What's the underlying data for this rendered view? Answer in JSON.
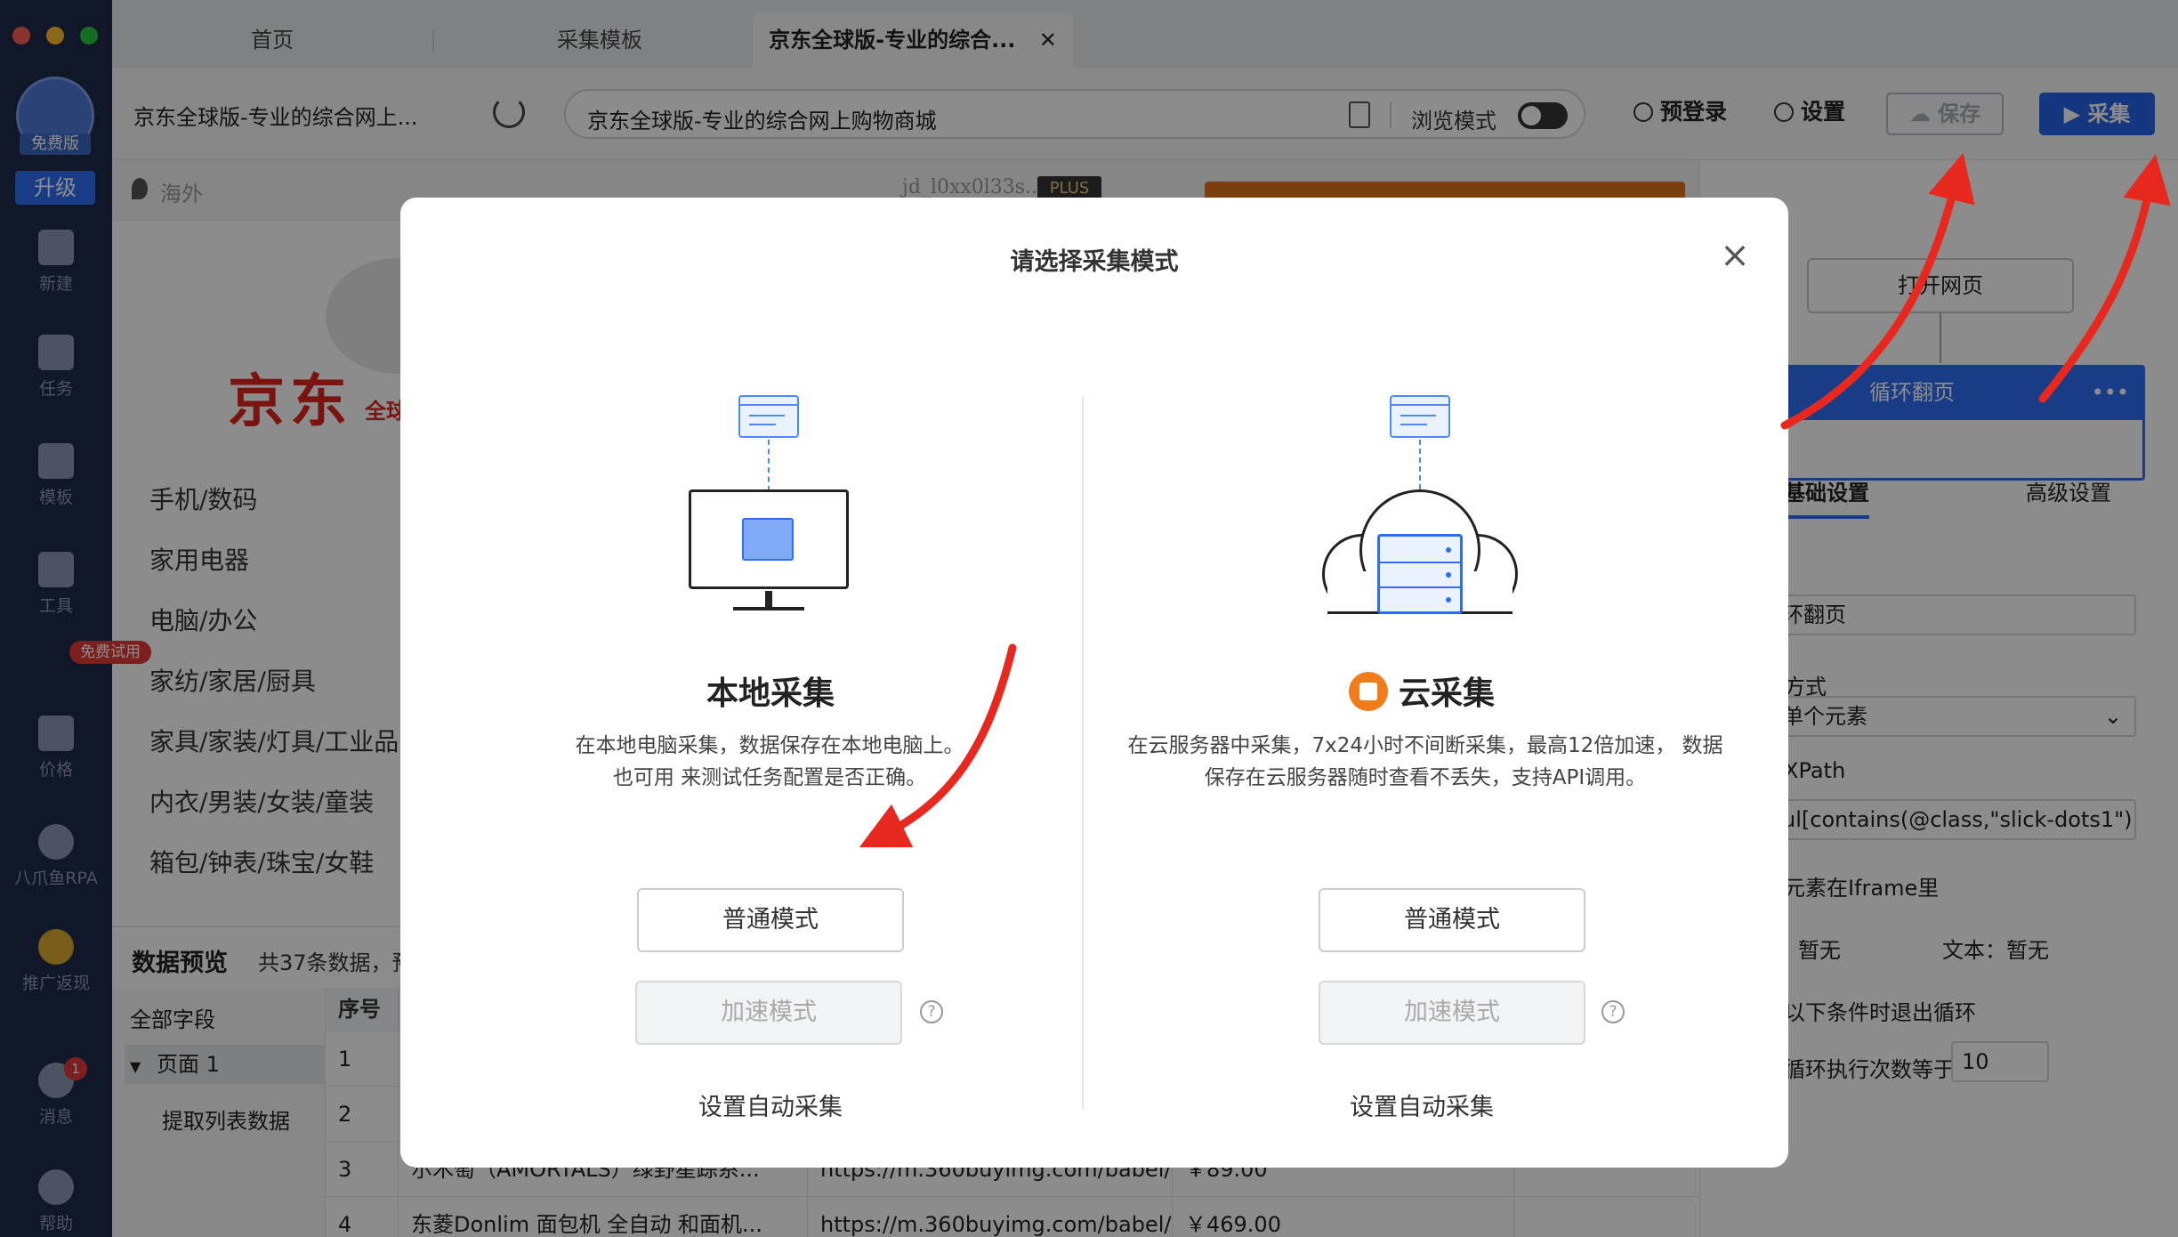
{
  "sidebar": {
    "free_badge": "免费版",
    "upgrade": "升级",
    "items": [
      {
        "label": "新建",
        "icon": "plus-icon"
      },
      {
        "label": "任务",
        "icon": "task-icon"
      },
      {
        "label": "模板",
        "icon": "template-icon"
      },
      {
        "label": "工具",
        "icon": "toolbox-icon"
      },
      {
        "label": "价格",
        "icon": "crown-icon"
      },
      {
        "label": "八爪鱼RPA",
        "icon": "octopus-icon"
      },
      {
        "label": "推广返现",
        "icon": "coin-icon"
      },
      {
        "label": "消息",
        "icon": "bell-icon"
      },
      {
        "label": "帮助",
        "icon": "help-icon"
      }
    ],
    "trial_badge": "免费试用",
    "message_count": "1"
  },
  "tabs": [
    {
      "label": "首页"
    },
    {
      "label": "采集模板"
    },
    {
      "label": "京东全球版-专业的综合..."
    }
  ],
  "toolbar": {
    "page_title": "京东全球版-专业的综合网上...",
    "url": "京东全球版-专业的综合网上购物商城",
    "browse_mode": "浏览模式",
    "prelogin": "预登录",
    "settings": "设置",
    "save": "保存",
    "collect": "采集"
  },
  "jd_page": {
    "location": "海外",
    "account": "jd_l0xx0l33s..",
    "plus": "PLUS",
    "logo": "京东",
    "global": "全球",
    "categories": [
      "手机/数码",
      "家用电器",
      "电脑/办公",
      "家纺/家居/厨具",
      "家具/家装/灯具/工业品",
      "内衣/男装/女装/童装",
      "箱包/钟表/珠宝/女鞋"
    ]
  },
  "preview": {
    "title": "数据预览",
    "count": "共37条数据，预",
    "all_fields": "全部字段",
    "page": "页面 1",
    "extract": "提取列表数据",
    "index_header": "序号",
    "rows": [
      {
        "index": "1",
        "name": "",
        "url": "",
        "price": ""
      },
      {
        "index": "2",
        "name": "",
        "url": "",
        "price": ""
      },
      {
        "index": "3",
        "name": "尔木萄（AMORTALS）绿野星踪系...",
        "url": "https://m.360buyimg.com/babel/...",
        "price": "￥89.00"
      },
      {
        "index": "4",
        "name": "东菱Donlim 面包机 全自动 和面机...",
        "url": "https://m.360buyimg.com/babel/...",
        "price": "￥469.00"
      }
    ]
  },
  "right_panel": {
    "open_page": "打开网页",
    "loop_page": "循环翻页",
    "tab_basic": "基础设置",
    "tab_advanced": "高级设置",
    "name_value": "环翻页",
    "mode_label": "方式",
    "mode_value": "单个元素",
    "xpath_label": "XPath",
    "xpath_value": "ul[contains(@class,\"slick-dots1\")",
    "iframe_label": "元素在Iframe里",
    "element_label": "暂无",
    "text_label": "文本：",
    "text_value": "暂无",
    "exit_label": "以下条件时退出循环",
    "count_label": "循环执行次数等于",
    "count_value": "10"
  },
  "modal": {
    "title": "请选择采集模式",
    "local": {
      "title": "本地采集",
      "desc1": "在本地电脑采集，数据保存在本地电脑上。",
      "desc2": "也可用 来测试任务配置是否正确。",
      "normal": "普通模式",
      "fast": "加速模式",
      "auto": "设置自动采集"
    },
    "cloud": {
      "title": "云采集",
      "desc": "在云服务器中采集，7x24小时不间断采集，最高12倍加速， 数据保存在云服务器随时查看不丢失，支持API调用。",
      "normal": "普通模式",
      "fast": "加速模式",
      "auto": "设置自动采集"
    }
  },
  "colors": {
    "accent": "#2565e8",
    "arrow": "#e8281e",
    "sidebar": "#1c2a4a"
  }
}
